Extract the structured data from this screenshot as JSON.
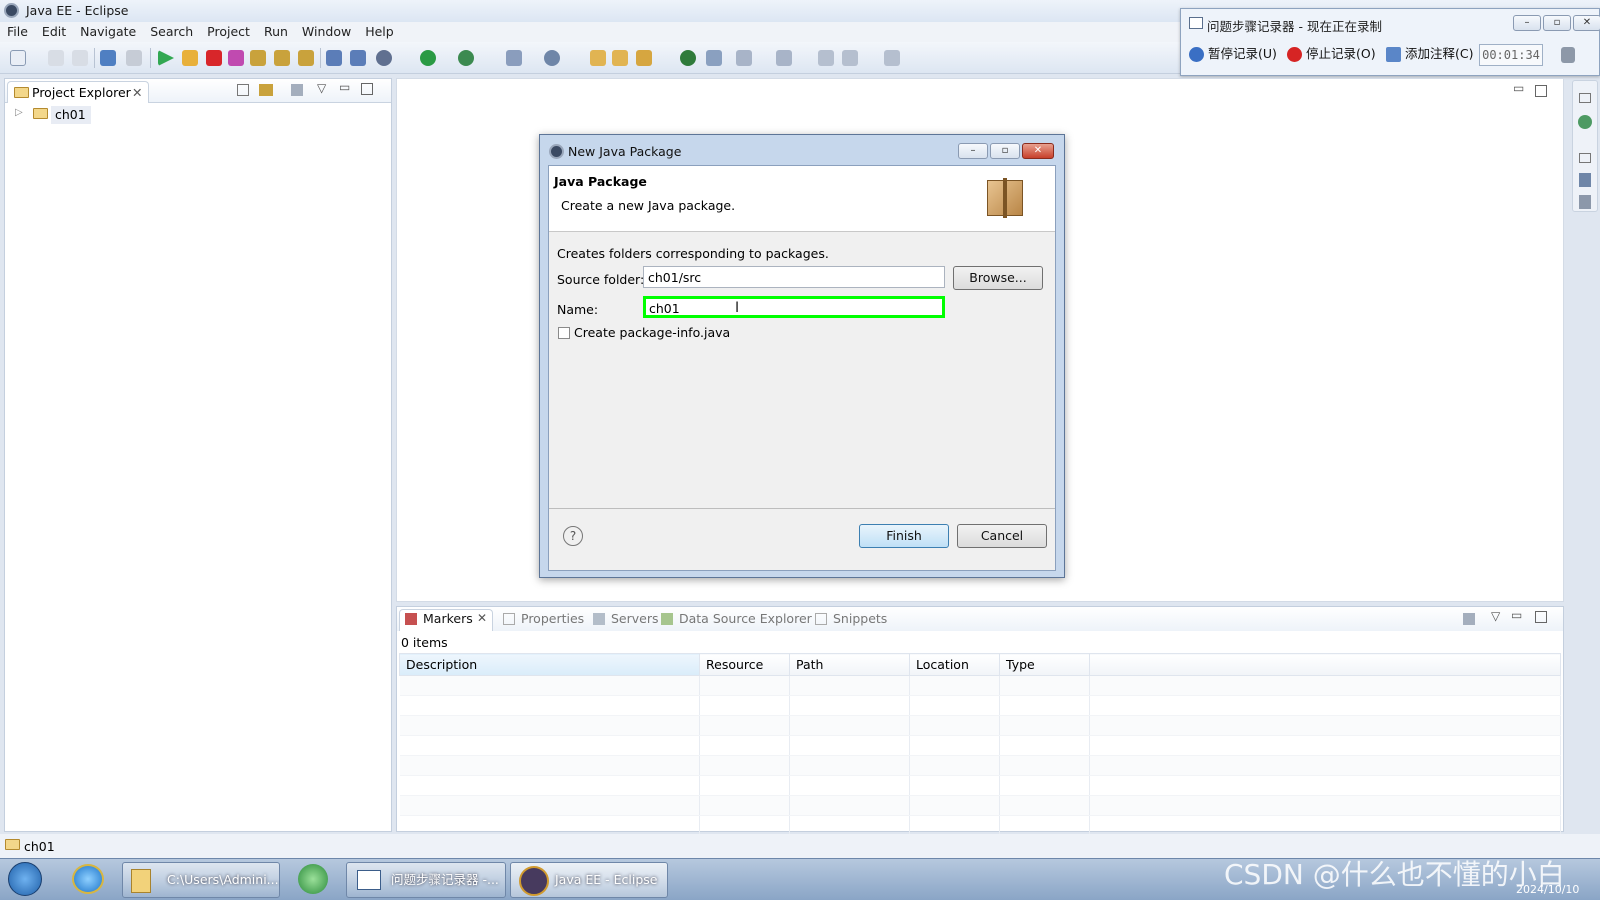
{
  "window": {
    "title": "Java EE - Eclipse"
  },
  "menu": [
    "File",
    "Edit",
    "Navigate",
    "Search",
    "Project",
    "Run",
    "Window",
    "Help"
  ],
  "recorder": {
    "title": "问题步骤记录器 - 现在正在录制",
    "pause": "暂停记录(U)",
    "stop": "停止记录(O)",
    "comment": "添加注释(C)",
    "elapsed": "00:01:34"
  },
  "project_explorer": {
    "tab_label": "Project Explorer",
    "items": [
      {
        "label": "ch01"
      }
    ]
  },
  "dialog": {
    "title": "New Java Package",
    "heading": "Java Package",
    "subtitle": "Create a new Java package.",
    "description": "Creates folders corresponding to packages.",
    "source_folder_label": "Source folder:",
    "source_folder_value": "ch01/src",
    "browse_label": "Browse...",
    "name_label": "Name:",
    "name_value": "ch01",
    "checkbox_label": "Create package-info.java",
    "finish_label": "Finish",
    "cancel_label": "Cancel",
    "help_label": "?"
  },
  "bottom_panel": {
    "tabs": [
      "Markers",
      "Properties",
      "Servers",
      "Data Source Explorer",
      "Snippets"
    ],
    "count_text": "0 items",
    "columns": [
      "Description",
      "Resource",
      "Path",
      "Location",
      "Type"
    ]
  },
  "status_bar": {
    "text": "ch01"
  },
  "taskbar": {
    "items": [
      "C:\\Users\\Admini...",
      "问题步骤记录器 -...",
      "Java EE - Eclipse"
    ],
    "date": "2024/10/10",
    "watermark": "CSDN @什么也不懂的小白"
  },
  "colors": {
    "highlight": "#00ff00",
    "accent": "#3c7fb1"
  }
}
